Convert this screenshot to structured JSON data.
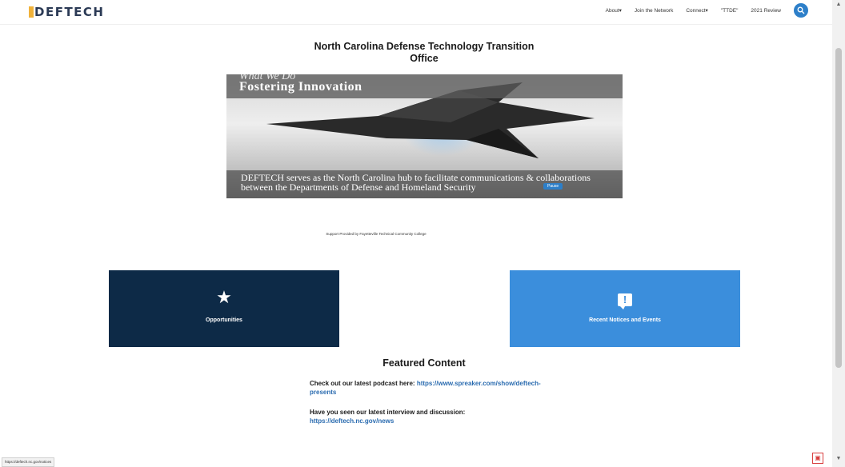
{
  "header": {
    "logo_text": "DEFTECH",
    "nav": [
      {
        "label": "About"
      },
      {
        "label": "Join the Network"
      },
      {
        "label": "Connect"
      },
      {
        "label": "TTDE"
      },
      {
        "label": "2021 Review"
      }
    ],
    "search_icon": "search-icon"
  },
  "site_title_line1": "North Carolina Defense Technology Transition",
  "site_title_line2": "Office",
  "hero": {
    "kicker": "What We Do",
    "heading": "Fostering Innovation",
    "caption": "DEFTECH serves as the North Carolina hub to facilitate communications & collaborations between the Departments of Defense and Homeland Security",
    "pause_label": "Pause"
  },
  "support_text": "Support Provided by Fayetteville Technical Community College",
  "cards": [
    {
      "label": "Opportunities",
      "icon": "star-icon",
      "color": "#0d2a47"
    },
    {
      "label": "Recent Notices and Events",
      "icon": "exclamation-speech-icon",
      "color": "#3b8edc"
    }
  ],
  "featured": {
    "title": "Featured Content",
    "item1_prefix": "Check out our latest podcast here: ",
    "item1_link": "https://www.spreaker.com/show/deftech-presents",
    "item2_prefix": "Have you seen our latest interview and discussion: ",
    "item2_link": "https://deftech.nc.gov/news"
  },
  "status_bar_url": "https://deftech.nc.gov/notices",
  "colors": {
    "navy": "#0d2a47",
    "blue": "#3b8edc",
    "link": "#2b6cb0",
    "accent": "#f0b23a"
  }
}
